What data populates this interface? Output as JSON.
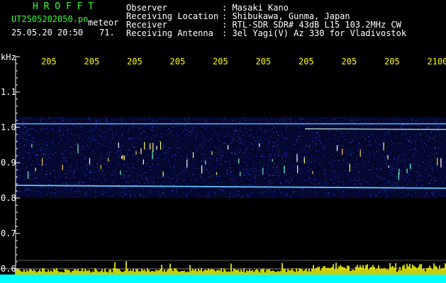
{
  "header": {
    "program_name": "H R O F F T",
    "file_name": "UT2505202050.pn",
    "file_suffix": "meteor",
    "date_time": "25.05.20 20:50",
    "count": "71."
  },
  "info": {
    "observer_label": "Observer",
    "observer_value": ": Masaki Kano",
    "location_label": "Receiving Location",
    "location_value": ": Shibukawa, Gunma, Japan",
    "receiver_label": "Receiver",
    "receiver_value": ": RTL-SDR SDR# 43dB L15 103.2MHz CW",
    "antenna_label": "Receiving Antenna",
    "antenna_value": ": 3el Yagi(V) Az 330 for Vladivostok"
  },
  "axis": {
    "unit": "kHz",
    "y_ticks": [
      "1.1",
      "1.0",
      "0.9",
      "0.8",
      "0.7",
      "0.6"
    ],
    "time_ticks": [
      "205",
      "205",
      "205",
      "205",
      "205",
      "205",
      "205",
      "205",
      "205",
      "2100"
    ]
  },
  "colors": {
    "header_green": "#33ff33",
    "time_tick_yellow": "#ffff00",
    "bottom_bar_cyan": "#00ffff",
    "waterfall_blue": "#1a2dff",
    "carrier_line": "#9fe8ff"
  }
}
